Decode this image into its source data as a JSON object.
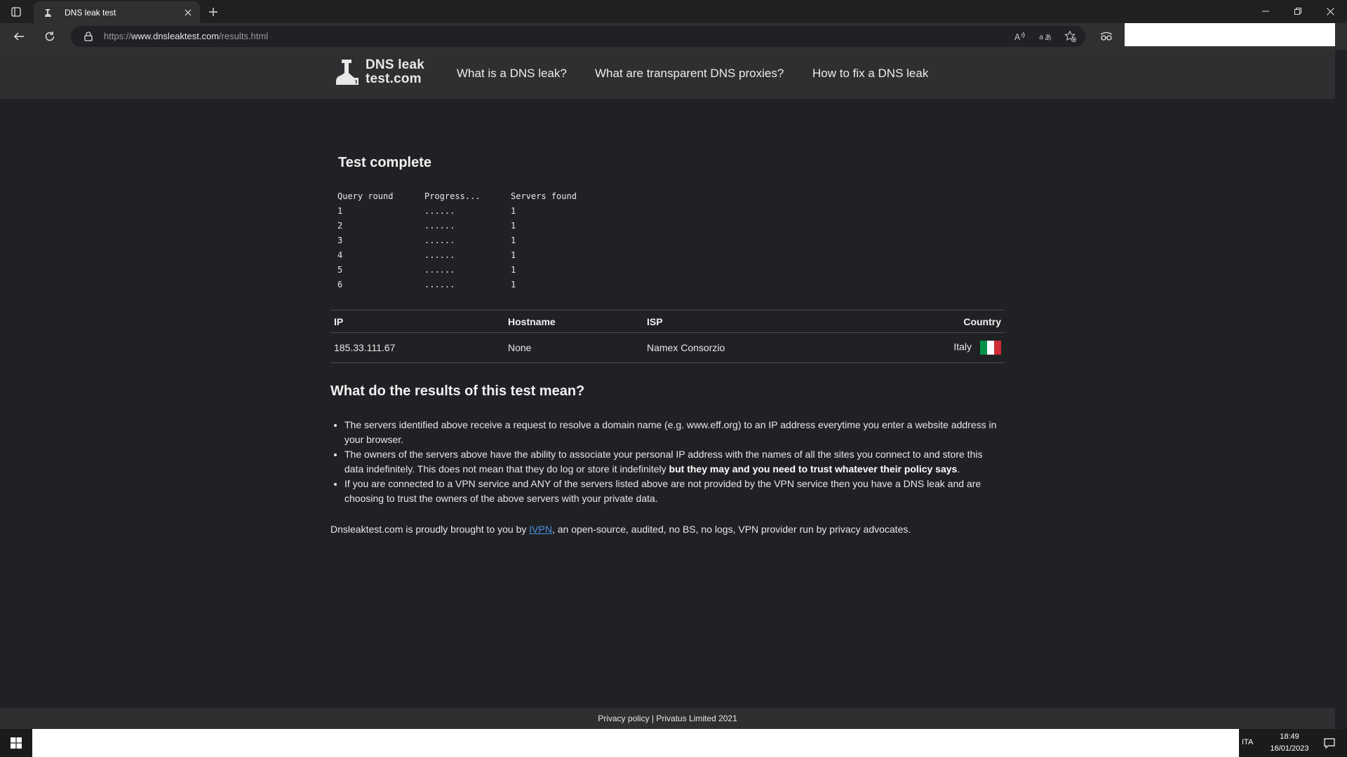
{
  "browser": {
    "tab_title": "DNS leak test",
    "url_scheme": "https://",
    "url_domain": "www.dnsleaktest.com",
    "url_path": "/results.html"
  },
  "site": {
    "logo_line1": "DNS leak",
    "logo_line2": "test.com",
    "nav": [
      {
        "label": "What is a DNS leak?"
      },
      {
        "label": "What are transparent DNS proxies?"
      },
      {
        "label": "How to fix a DNS leak"
      }
    ]
  },
  "test": {
    "title": "Test complete",
    "headers": [
      "Query round",
      "Progress...",
      "Servers found"
    ],
    "rounds": [
      {
        "round": "1",
        "progress": "......",
        "found": "1"
      },
      {
        "round": "2",
        "progress": "......",
        "found": "1"
      },
      {
        "round": "3",
        "progress": "......",
        "found": "1"
      },
      {
        "round": "4",
        "progress": "......",
        "found": "1"
      },
      {
        "round": "5",
        "progress": "......",
        "found": "1"
      },
      {
        "round": "6",
        "progress": "......",
        "found": "1"
      }
    ]
  },
  "results": {
    "headers": {
      "ip": "IP",
      "hostname": "Hostname",
      "isp": "ISP",
      "country": "Country"
    },
    "rows": [
      {
        "ip": "185.33.111.67",
        "hostname": "None",
        "isp": "Namex Consorzio",
        "country": "Italy",
        "flag": "italy-flag-icon"
      }
    ]
  },
  "explanation": {
    "title": "What do the results of this test mean?",
    "bullet1": "The servers identified above receive a request to resolve a domain name (e.g. www.eff.org) to an IP address everytime you enter a website address in your browser.",
    "bullet2_text": "The owners of the servers above have the ability to associate your personal IP address with the names of all the sites you connect to and store this data indefinitely. This does not mean that they do log or store it indefinitely ",
    "bullet2_bold": "but they may and you need to trust whatever their policy says",
    "bullet2_end": ".",
    "bullet3": "If you are connected to a VPN service and ANY of the servers listed above are not provided by the VPN service then you have a DNS leak and are choosing to trust the owners of the above servers with your private data."
  },
  "credit": {
    "prefix": "Dnsleaktest.com is proudly brought to you by ",
    "link": "IVPN",
    "suffix": ", an open-source, audited, no BS, no logs, VPN provider run by privacy advocates."
  },
  "footer": {
    "privacy": "Privacy policy",
    "separator": " | ",
    "company": "Privatus Limited 2021"
  },
  "taskbar": {
    "language": "ITA",
    "time": "18:49",
    "date": "16/01/2023"
  },
  "colors": {
    "page_bg": "#202124",
    "header_bg": "#2d2f31",
    "link": "#4a90e2",
    "flag_green": "#009246",
    "flag_white": "#ffffff",
    "flag_red": "#ce2b37"
  }
}
